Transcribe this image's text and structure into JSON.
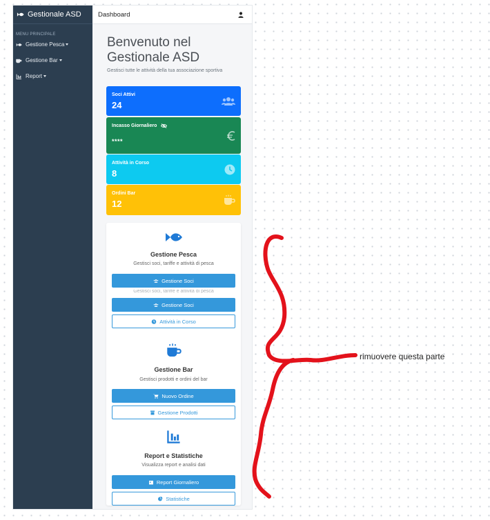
{
  "sidebar": {
    "brand": "Gestionale ASD",
    "menu_title": "MENU PRINCIPALE",
    "items": [
      {
        "label": "Gestione Pesca",
        "icon": "fish-icon"
      },
      {
        "label": "Gestione Bar",
        "icon": "coffee-icon"
      },
      {
        "label": "Report",
        "icon": "chart-icon"
      }
    ]
  },
  "topbar": {
    "title": "Dashboard",
    "user_icon": "user-icon"
  },
  "welcome": {
    "title": "Benvenuto nel Gestionale ASD",
    "subtitle": "Gestisci tutte le attività della tua associazione sportiva"
  },
  "stats": [
    {
      "label": "Soci Attivi",
      "value": "24",
      "icon": "users-icon",
      "color": "#0d6efd"
    },
    {
      "label": "Incasso Giornaliero",
      "value": "****",
      "icon": "euro-icon",
      "toggle_icon": "eye-slash-icon",
      "color": "#198754"
    },
    {
      "label": "Attività in Corso",
      "value": "8",
      "icon": "clock-icon",
      "color": "#0dcaf0"
    },
    {
      "label": "Ordini Bar",
      "value": "12",
      "icon": "coffee-icon",
      "color": "#ffc107"
    }
  ],
  "sections": {
    "pesca": {
      "title": "Gestione Pesca",
      "desc": "Gestisci soci, tariffe e attività di pesca",
      "btn_soci": "Gestione Soci",
      "btn_soci_dup": "Gestione Soci",
      "btn_attivita": "Attività in Corso"
    },
    "bar": {
      "title": "Gestione Bar",
      "desc": "Gestisci prodotti e ordini del bar",
      "btn_ordine": "Nuovo Ordine",
      "btn_prodotti": "Gestione Prodotti"
    },
    "report": {
      "title": "Report e Statistiche",
      "desc": "Visualizza report e analisi dati",
      "btn_giornaliero": "Report Giornaliero",
      "btn_statistiche": "Statistiche"
    }
  },
  "annotation": {
    "text": "rimuovere questa parte",
    "color": "#e3121b"
  },
  "colors": {
    "sidebar": "#2c3e50",
    "primary": "#3498db"
  }
}
